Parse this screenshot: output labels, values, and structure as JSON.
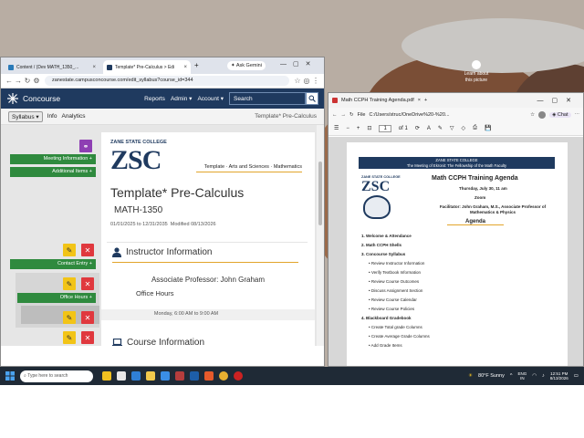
{
  "colors": {
    "brand_navy": "#1f3a5f",
    "button_green": "#2f8a3e",
    "edit_yellow": "#f2c417",
    "delete_red": "#e0383e",
    "link_purple": "#8e3fb3"
  },
  "desktop": {
    "icon_label": "Learn about this picture"
  },
  "chrome": {
    "tabs": [
      {
        "label": "Content / (Dev MATH_1350_...",
        "icon": "d2l-icon"
      },
      {
        "label": "Template* Pre-Calculus > Edi",
        "icon": "concourse-icon",
        "active": true
      }
    ],
    "new_tab": "+",
    "ask_gemini": "Ask Gemini",
    "url": "zanestate.campusconcourse.com/edit_syllabus?course_id=344"
  },
  "concourse": {
    "logo": "Concourse",
    "nav": [
      "Reports",
      "Admin ▾",
      "Account ▾"
    ],
    "search_placeholder": "Search",
    "subnav": {
      "syllabus": "Syllabus ▾",
      "info": "Info",
      "analytics": "Analytics",
      "crumb": "Template* Pre-Calculus"
    },
    "left_buttons": {
      "meeting": "Meeting Information +",
      "additional": "Additional Items +",
      "contact": "Contact Entry +",
      "office": "Office Hours +"
    },
    "college_name": "ZANE STATE COLLEGE",
    "college_logo": "ZSC",
    "template_line": "Template · Arts and Sciences · Mathematics",
    "course_title": "Template* Pre-Calculus",
    "course_code": "MATH-1350",
    "dates": "01/01/2025 to 12/31/2035",
    "modified": "Modified 08/13/2026",
    "instructor_heading": "Instructor Information",
    "instructor": "Associate Professor: John Graham",
    "office_hours_label": "Office Hours",
    "office_hours_time": "Monday, 6:00 AM to 9:00 AM",
    "course_info_heading": "Course Information"
  },
  "pdf": {
    "title": "Math CCPH Training Agenda.pdf",
    "path": "C:/Users/struc/OneDrive%20-%20...",
    "page": "1",
    "of": "of 1",
    "chat": "Chat",
    "banner_line1": "ZANE STATE COLLEGE",
    "banner_line2": "The Meeting of Ekronit: The Fellowship of the Math Faculty",
    "college": "ZANE STATE COLLEGE",
    "heading": "Math CCPH Training Agenda",
    "date": "Thursday, July 30, 11 am",
    "location": "Zoom",
    "facilitator": "Facilitator: John Graham, M.S., Associate Professor of Mathematics & Physics",
    "agenda": "Agenda",
    "items": [
      {
        "t": "1. Welcome & Attendance",
        "b": true
      },
      {
        "t": "2. Math CCPH Shells",
        "b": true
      },
      {
        "t": "3. Concourse Syllabus",
        "b": true
      },
      {
        "t": "• Review Instructor Information",
        "b": false
      },
      {
        "t": "• Verify Textbook Information",
        "b": false
      },
      {
        "t": "• Review Course Outcomes",
        "b": false
      },
      {
        "t": "• Discuss Assignment Section",
        "b": false
      },
      {
        "t": "• Review Course Calendar",
        "b": false
      },
      {
        "t": "• Review Course Policies",
        "b": false
      },
      {
        "t": "4. Blackboard Gradebook",
        "b": true
      },
      {
        "t": "• Create Total grade Columns",
        "b": false
      },
      {
        "t": "• Create Average Grade Columns",
        "b": false
      },
      {
        "t": "• Add Grade Items",
        "b": false
      }
    ]
  },
  "taskbar": {
    "search": "Type here to search",
    "weather": "80°F Sunny",
    "lang": "ENG",
    "region": "IN",
    "time": "12:51 PM",
    "date": "8/13/2026"
  }
}
